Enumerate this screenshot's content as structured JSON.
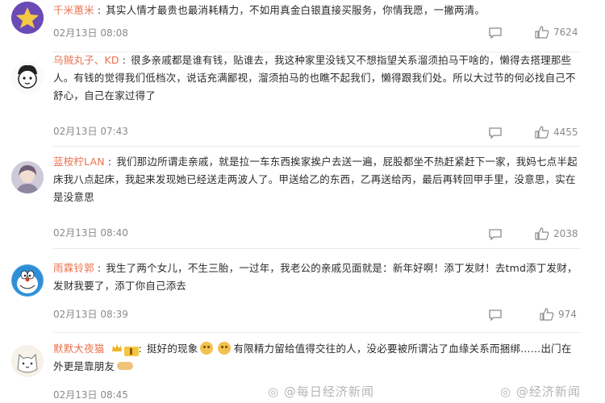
{
  "comments": [
    {
      "username": "千米蕙米",
      "text": "其实人情才最贵也最消耗精力，不如用真金白银直接买服务，你情我愿，一撇两清。",
      "timestamp": "02月13日 08:08",
      "likes": "7624",
      "avatar_color": "#7b56c6"
    },
    {
      "username": "乌贼丸子、KD",
      "text": "很多亲戚都是谁有钱，贴谁去，我这种家里没钱又不想指望关系溜须拍马干啥的，懒得去搭理那些人。有钱的觉得我们低档次，说话充满鄙视，溜须拍马的也瞧不起我们，懒得跟我们处。所以大过节的何必找自己不舒心，自己在家过得了",
      "timestamp": "02月13日 07:43",
      "likes": "4455",
      "avatar_color": "#f4f4f4"
    },
    {
      "username": "蓝桉柠LAN",
      "text": "我们那边所谓走亲戚，就是拉一车东西挨家挨户去送一遍，屁股都坐不热赶紧赶下一家，我妈七点半起床我八点起床，我起来发现她已经送走两波人了。甲送给乙的东西，乙再送给丙，最后再转回甲手里，没意思，实在是没意思",
      "timestamp": "02月13日 08:40",
      "likes": "2038",
      "avatar_color": "#c9c4d2"
    },
    {
      "username": "雨霖铃郭",
      "text": "我生了两个女儿，不生三胎，一过年，我老公的亲戚见面就是：新年好啊！添丁发财！去tmd添丁发财，发财我要了，添丁你自己添去",
      "timestamp": "02月13日 08:39",
      "likes": "974",
      "avatar_color": "#4aa3e0"
    },
    {
      "username": "默默大夜猫",
      "text_a": "挺好的现象",
      "text_b": "有限精力留给值得交往的人，没必要被所谓沾了血缘关系而捆绑……出门在外更是靠朋友",
      "timestamp": "02月13日 08:45",
      "avatar_color": "#f3f0e8"
    }
  ],
  "watermark": {
    "left": "@每日经济新闻",
    "right": "@经济新闻"
  },
  "colors": {
    "username": "#eb7350",
    "meta": "#8a8a8a"
  }
}
